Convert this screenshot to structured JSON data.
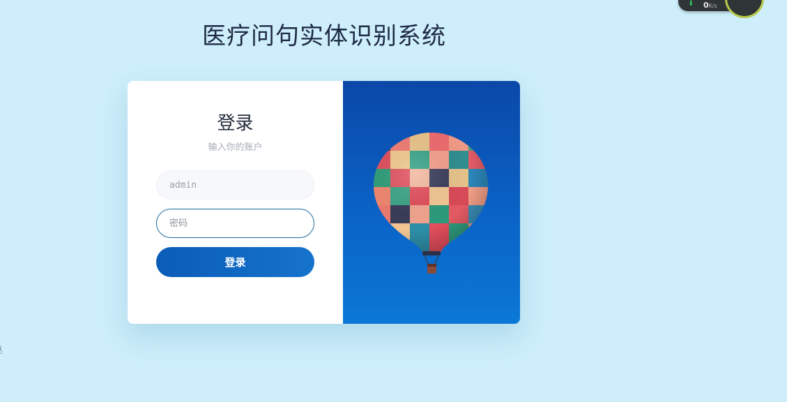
{
  "page": {
    "title": "医疗问句实体识别系统"
  },
  "login": {
    "title": "登录",
    "subtitle": "输入你的账户",
    "username": {
      "value": "",
      "placeholder": "admin"
    },
    "password": {
      "value": "",
      "placeholder": "密码"
    },
    "submit_label": "登录"
  },
  "photo": {
    "subject": "hot-air-balloon"
  },
  "speed_widget": {
    "value": "0",
    "unit": "K/s"
  },
  "colors": {
    "background": "#cdeefa",
    "button": "#0a5cb8",
    "photo_sky": "#0a63c6"
  }
}
